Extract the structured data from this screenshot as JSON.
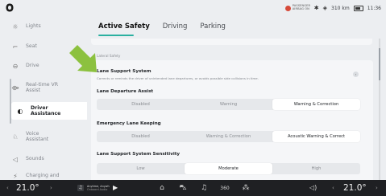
{
  "status_bar": {
    "airbag_text": "PASSENGER AIRBAG ON",
    "bluetooth_icon": "bluetooth-icon",
    "wifi_icon": "wifi-icon",
    "range": "310 km",
    "time": "11:36"
  },
  "sidebar": {
    "items": [
      {
        "label": "Lights",
        "icon": "lights-icon"
      },
      {
        "label": "Seat",
        "icon": "seat-icon"
      },
      {
        "label": "Drive",
        "icon": "drive-icon"
      },
      {
        "label": "Real-time VR Assist",
        "icon": "vr-assist-icon"
      },
      {
        "label": "Driver Assistance",
        "icon": "driver-assistance-icon"
      },
      {
        "label": "Voice Assistant",
        "icon": "voice-icon"
      },
      {
        "label": "Sounds",
        "icon": "sound-icon"
      },
      {
        "label": "Charging and",
        "icon": "charging-icon"
      }
    ]
  },
  "tabs": [
    "Active Safety",
    "Driving",
    "Parking"
  ],
  "content": {
    "section_title": "Lateral Safety",
    "lane_support": {
      "title": "Lane Support System",
      "description": "Corrects or reminds the driver of unintended lane departures, or avoids possible side collisions in time."
    },
    "lane_departure": {
      "title": "Lane Departure Assist",
      "options": [
        "Disabled",
        "Warning",
        "Warning & Correction"
      ],
      "selected": 2
    },
    "emergency_lane": {
      "title": "Emergency Lane Keeping",
      "options": [
        "Disabled",
        "Warning & Correction",
        "Acoustic Warning & Correct"
      ],
      "selected": 2
    },
    "sensitivity": {
      "title": "Lane Support System Sensitivity",
      "options": [
        "Low",
        "Moderate",
        "High"
      ],
      "selected": 1
    }
  },
  "bottom_bar": {
    "left_temp": "21.0°",
    "right_temp": "21.0°",
    "media_title": "Anytime, Anywh",
    "media_source": "Onboard Audio",
    "dock_icons": [
      "home-icon",
      "car-icon",
      "music-icon",
      "360-camera-icon",
      "apps-icon"
    ],
    "dock_labels": [
      "⌂",
      "⛍",
      "♫",
      "360",
      "⁂"
    ]
  },
  "colors": {
    "accent": "#2bb0a0",
    "arrow": "#8cc13f",
    "airbag": "#d64a3a"
  }
}
